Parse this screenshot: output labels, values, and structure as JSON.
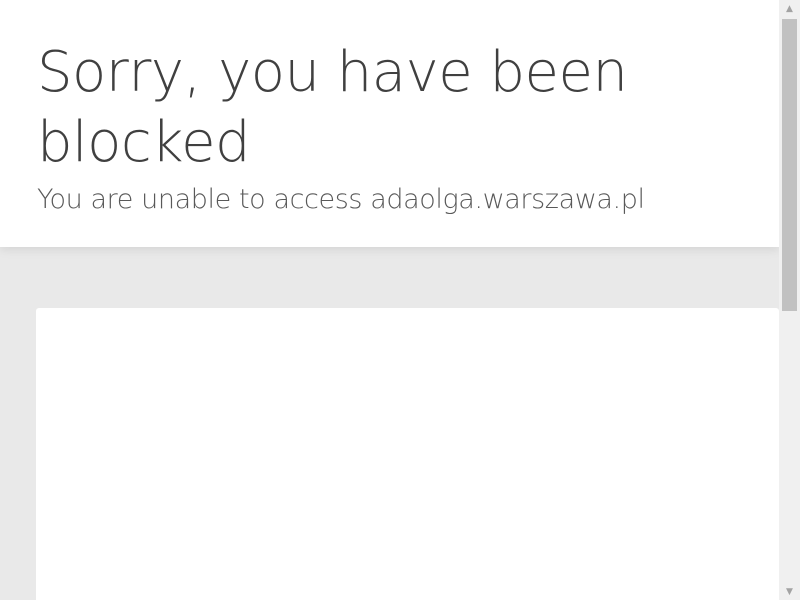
{
  "header": {
    "title": "Sorry, you have been blocked",
    "subtitle": "You are unable to access adaolga.warszawa.pl"
  },
  "scrollbar": {
    "up_icon": "▲",
    "down_icon": "▼"
  },
  "colors": {
    "page_background": "#e9e9e9",
    "header_background": "#ffffff",
    "title_text": "#404040",
    "subtitle_text": "#595959",
    "scrollbar_track": "#f0f0f0",
    "scrollbar_thumb": "#c1c1c1"
  }
}
